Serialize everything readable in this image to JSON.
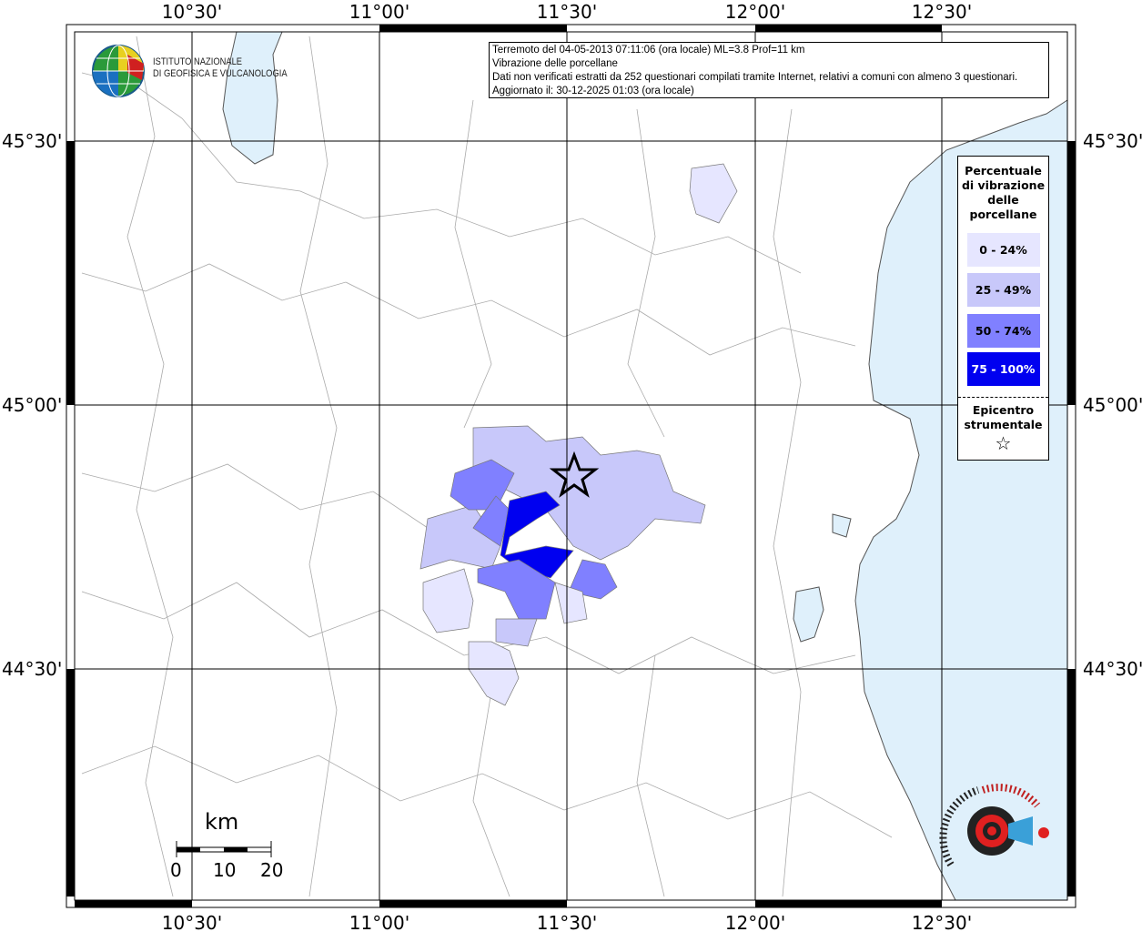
{
  "info_box": {
    "line1": "Terremoto del 04-05-2013 07:11:06 (ora locale) ML=3.8 Prof=11 km",
    "line2": "Vibrazione delle porcellane",
    "line3": "Dati non verificati estratti da 252 questionari compilati tramite Internet, relativi a comuni con almeno 3 questionari.",
    "line4": "Aggiornato il: 30-12-2025 01:03 (ora locale)"
  },
  "logo": {
    "line1": "ISTITUTO NAZIONALE",
    "line2": "DI GEOFISICA E VULCANOLOGIA"
  },
  "haisentito_logo": "www.haisentitoilterremoto.it",
  "legend": {
    "title_lines": [
      "Percentuale",
      "di vibrazione",
      "delle",
      "porcellane"
    ],
    "classes": [
      {
        "label": "0 - 24%",
        "color": "#e6e6ff",
        "text_color": "#000000"
      },
      {
        "label": "25 - 49%",
        "color": "#c8c8fa",
        "text_color": "#000000"
      },
      {
        "label": "50 - 74%",
        "color": "#8080ff",
        "text_color": "#000000"
      },
      {
        "label": "75 - 100%",
        "color": "#0000f0",
        "text_color": "#ffffff"
      }
    ],
    "epicenter_lines": [
      "Epicentro",
      "strumentale"
    ],
    "epicenter_symbol": "☆"
  },
  "axes": {
    "lon_labels": [
      "10°30'",
      "11°00'",
      "11°30'",
      "12°00'",
      "12°30'"
    ],
    "lat_labels": [
      "45°30'",
      "45°00'",
      "44°30'"
    ]
  },
  "scale_bar": {
    "unit": "km",
    "labels": [
      "0",
      "10",
      "20"
    ]
  },
  "colors": {
    "sea": "#dff0fb",
    "land": "#ffffff",
    "border": "#888888"
  }
}
